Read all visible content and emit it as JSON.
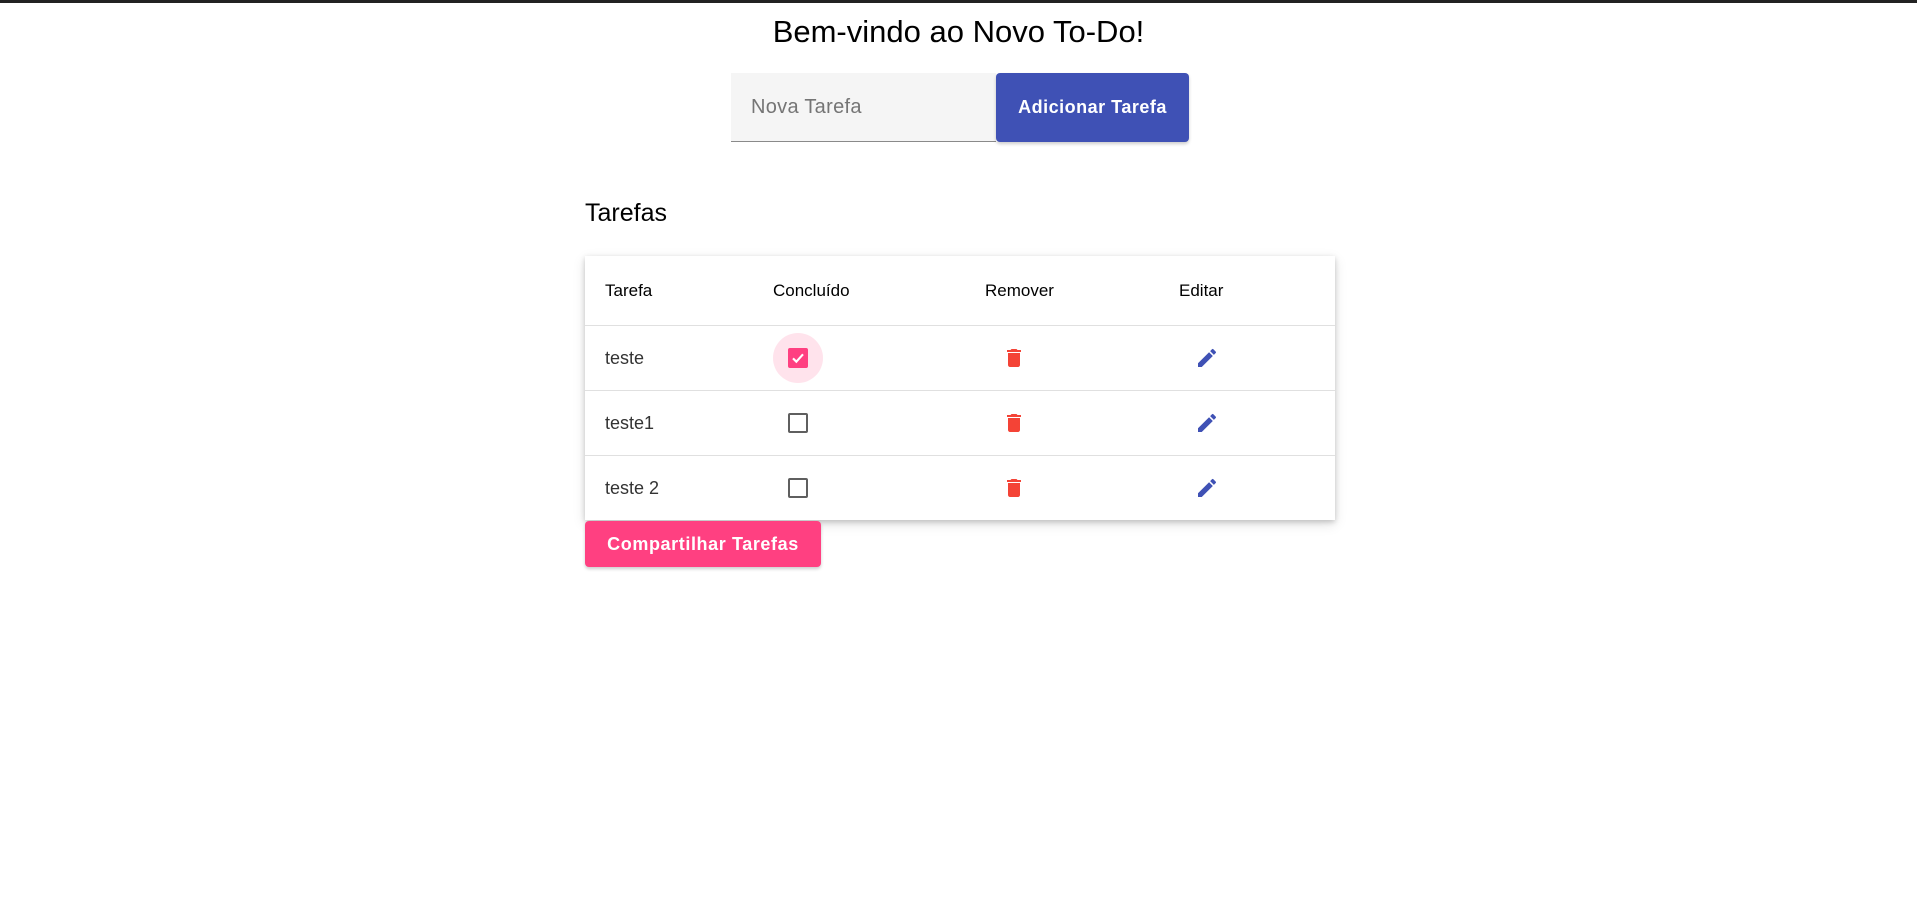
{
  "header": {
    "title": "Bem-vindo ao Novo To-Do!"
  },
  "new_task": {
    "placeholder": "Nova Tarefa",
    "value": "",
    "add_button_label": "Adicionar Tarefa"
  },
  "tasks_section": {
    "title": "Tarefas",
    "columns": [
      "Tarefa",
      "Concluído",
      "Remover",
      "Editar"
    ],
    "rows": [
      {
        "task": "teste",
        "done": true,
        "remove_icon": "delete-icon",
        "edit_icon": "edit-pencil-icon"
      },
      {
        "task": "teste1",
        "done": false,
        "remove_icon": "delete-icon",
        "edit_icon": "edit-pencil-icon"
      },
      {
        "task": "teste 2",
        "done": false,
        "remove_icon": "delete-icon",
        "edit_icon": "edit-pencil-icon"
      }
    ],
    "share_button_label": "Compartilhar Tarefas"
  },
  "colors": {
    "primary": "#3f51b5",
    "accent": "#ff4081",
    "delete": "#f44336",
    "background": "#ffffff"
  }
}
